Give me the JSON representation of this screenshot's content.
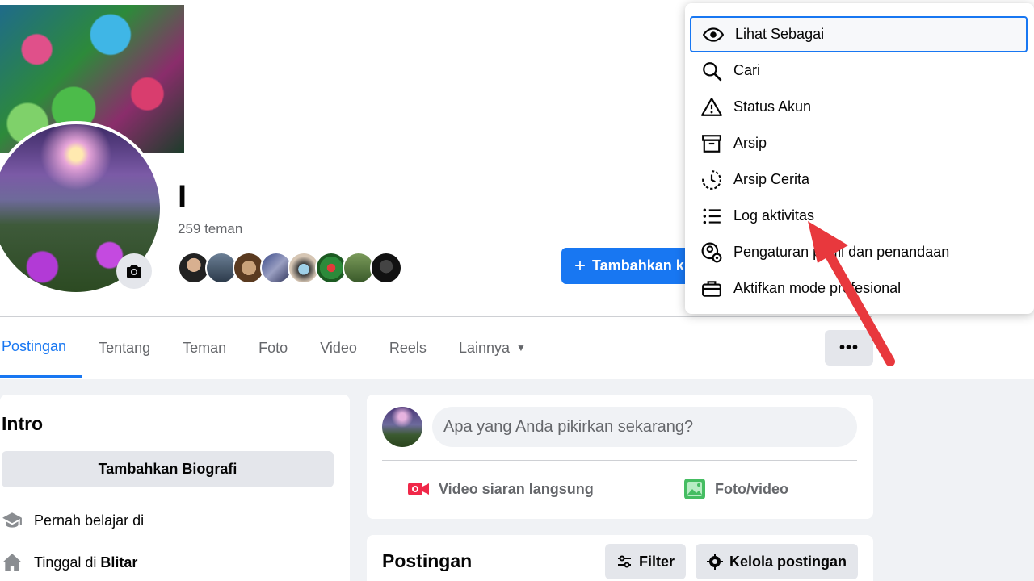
{
  "profile": {
    "name": "I",
    "friend_count": "259 teman",
    "add_story_label": "Tambahkan k"
  },
  "tabs": [
    {
      "label": "Postingan",
      "active": true
    },
    {
      "label": "Tentang"
    },
    {
      "label": "Teman"
    },
    {
      "label": "Foto"
    },
    {
      "label": "Video"
    },
    {
      "label": "Reels"
    },
    {
      "label": "Lainnya"
    }
  ],
  "more_button_label": "•••",
  "dropdown": {
    "items": [
      {
        "label": "Lihat Sebagai",
        "icon": "eye-icon"
      },
      {
        "label": "Cari",
        "icon": "search-icon"
      },
      {
        "label": "Status Akun",
        "icon": "warning-icon"
      },
      {
        "label": "Arsip",
        "icon": "archive-icon"
      },
      {
        "label": "Arsip Cerita",
        "icon": "story-archive-icon"
      },
      {
        "label": "Log aktivitas",
        "icon": "list-icon"
      },
      {
        "label": "Pengaturan profil dan penandaan",
        "icon": "profile-settings-icon"
      },
      {
        "label": "Aktifkan mode profesional",
        "icon": "briefcase-icon"
      }
    ]
  },
  "intro": {
    "title": "Intro",
    "add_bio": "Tambahkan Biografi",
    "studied": "Pernah belajar di",
    "lives_in_prefix": "Tinggal di ",
    "lives_in_city": "Blitar"
  },
  "composer": {
    "placeholder": "Apa yang Anda pikirkan sekarang?",
    "live_video": "Video siaran langsung",
    "photo_video": "Foto/video"
  },
  "posts": {
    "title": "Postingan",
    "filter": "Filter",
    "manage": "Kelola postingan"
  },
  "colors": {
    "accent": "#1877f2",
    "annotation_arrow": "#e8383d"
  }
}
